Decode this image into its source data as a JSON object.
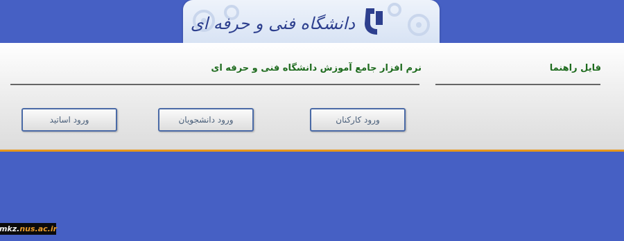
{
  "header": {
    "logo_text": "دانشگاه فنی و حرفه ای",
    "logo_small": "دانشگاه"
  },
  "panel": {
    "help_link": "فایل راهنما",
    "system_title": "نرم افزار جامع آموزش دانشگاه فنی و حرفه ای",
    "buttons": {
      "staff": "ورود کارکنان",
      "students": "ورود دانشجویان",
      "professors": "ورود اساتید"
    }
  },
  "footer": {
    "domain_prefix": "mkz.",
    "domain_accent": "nus.ac.ir"
  },
  "colors": {
    "background": "#4660c4",
    "title_green": "#1e6b1e",
    "accent_orange": "#e8961a"
  }
}
